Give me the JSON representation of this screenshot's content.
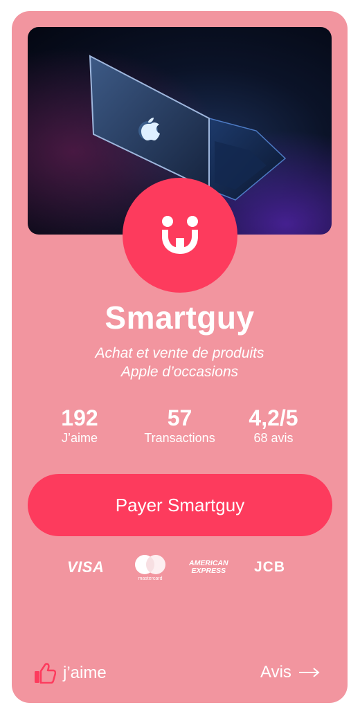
{
  "profile": {
    "name": "Smartguy",
    "tagline_line1": "Achat et vente de produits",
    "tagline_line2": "Apple d’occasions",
    "hero_image_icon": "laptop-photo",
    "logo_icon": "smiley-logo-icon"
  },
  "stats": [
    {
      "value": "192",
      "label": "J’aime"
    },
    {
      "value": "57",
      "label": "Transactions"
    },
    {
      "value": "4,2/5",
      "label": "68 avis"
    }
  ],
  "actions": {
    "pay_label": "Payer Smartguy",
    "like_label": "j’aime",
    "reviews_label": "Avis"
  },
  "payment_methods": {
    "visa": "VISA",
    "mastercard": "mastercard",
    "amex_line1": "AMERICAN",
    "amex_line2": "EXPRESS",
    "jcb": "JCB"
  },
  "colors": {
    "card_background": "#f2959f",
    "accent": "#fd3b5d",
    "text": "#ffffff"
  }
}
